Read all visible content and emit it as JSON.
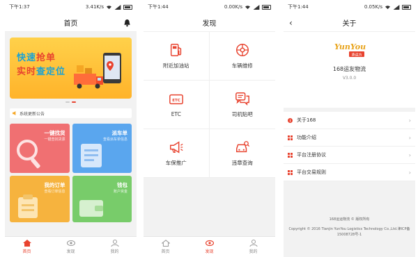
{
  "colors": {
    "accent": "#e8432f",
    "card_red": "#f07072",
    "card_blue": "#5aa6ee",
    "card_orange": "#f6b33e",
    "card_green": "#78cc6a"
  },
  "screen1": {
    "status_time": "下午1:37",
    "status_speed": "3.41K/s",
    "title": "首页",
    "banner_line1_a": "快速",
    "banner_line1_b": "抢单",
    "banner_line2_a": "实时",
    "banner_line2_b": "查定位",
    "notice": "系统更新公告",
    "cards": [
      {
        "title": "一键找货",
        "subtitle": "一键查找货源"
      },
      {
        "title": "派车单",
        "subtitle": "查看派车单信息"
      },
      {
        "title": "我的订单",
        "subtitle": "查看订单信息"
      },
      {
        "title": "钱包",
        "subtitle": "账户资金"
      }
    ],
    "tabs": [
      {
        "label": "首页",
        "icon": "home-icon"
      },
      {
        "label": "发现",
        "icon": "eye-icon"
      },
      {
        "label": "我的",
        "icon": "user-icon"
      }
    ]
  },
  "screen2": {
    "status_time": "下午1:44",
    "status_speed": "0.00K/s",
    "title": "发现",
    "items": [
      {
        "label": "附近加油站",
        "icon": "fuel-pump-icon"
      },
      {
        "label": "车辆维修",
        "icon": "wheel-icon"
      },
      {
        "label": "ETC",
        "icon": "etc-card-icon"
      },
      {
        "label": "司机贴吧",
        "icon": "chat-bubbles-icon"
      },
      {
        "label": "车保推广",
        "icon": "megaphone-icon"
      },
      {
        "label": "违章查询",
        "icon": "car-search-icon"
      }
    ],
    "tabs": [
      {
        "label": "首页",
        "icon": "home-icon"
      },
      {
        "label": "发现",
        "icon": "eye-icon"
      },
      {
        "label": "我的",
        "icon": "user-icon"
      }
    ]
  },
  "screen3": {
    "status_time": "下午1:44",
    "status_speed": "0.05K/s",
    "title": "关于",
    "logo_text": "YunYou",
    "logo_badge": "承运方",
    "app_name": "168运友物流",
    "version": "V3.0.0",
    "menu": [
      {
        "label": "关于168",
        "icon": "info-icon"
      },
      {
        "label": "功能介绍",
        "icon": "grid-icon"
      },
      {
        "label": "平台注册协议",
        "icon": "grid-icon"
      },
      {
        "label": "平台交易规则",
        "icon": "grid-icon"
      }
    ],
    "footer_line1": "168运运物流 © 版权所有",
    "footer_line2": "Copyright © 2016 Tianjin YunYou Logistics Technology Co.,Ltd.津ICP备",
    "footer_line3": "15008728号-1"
  }
}
